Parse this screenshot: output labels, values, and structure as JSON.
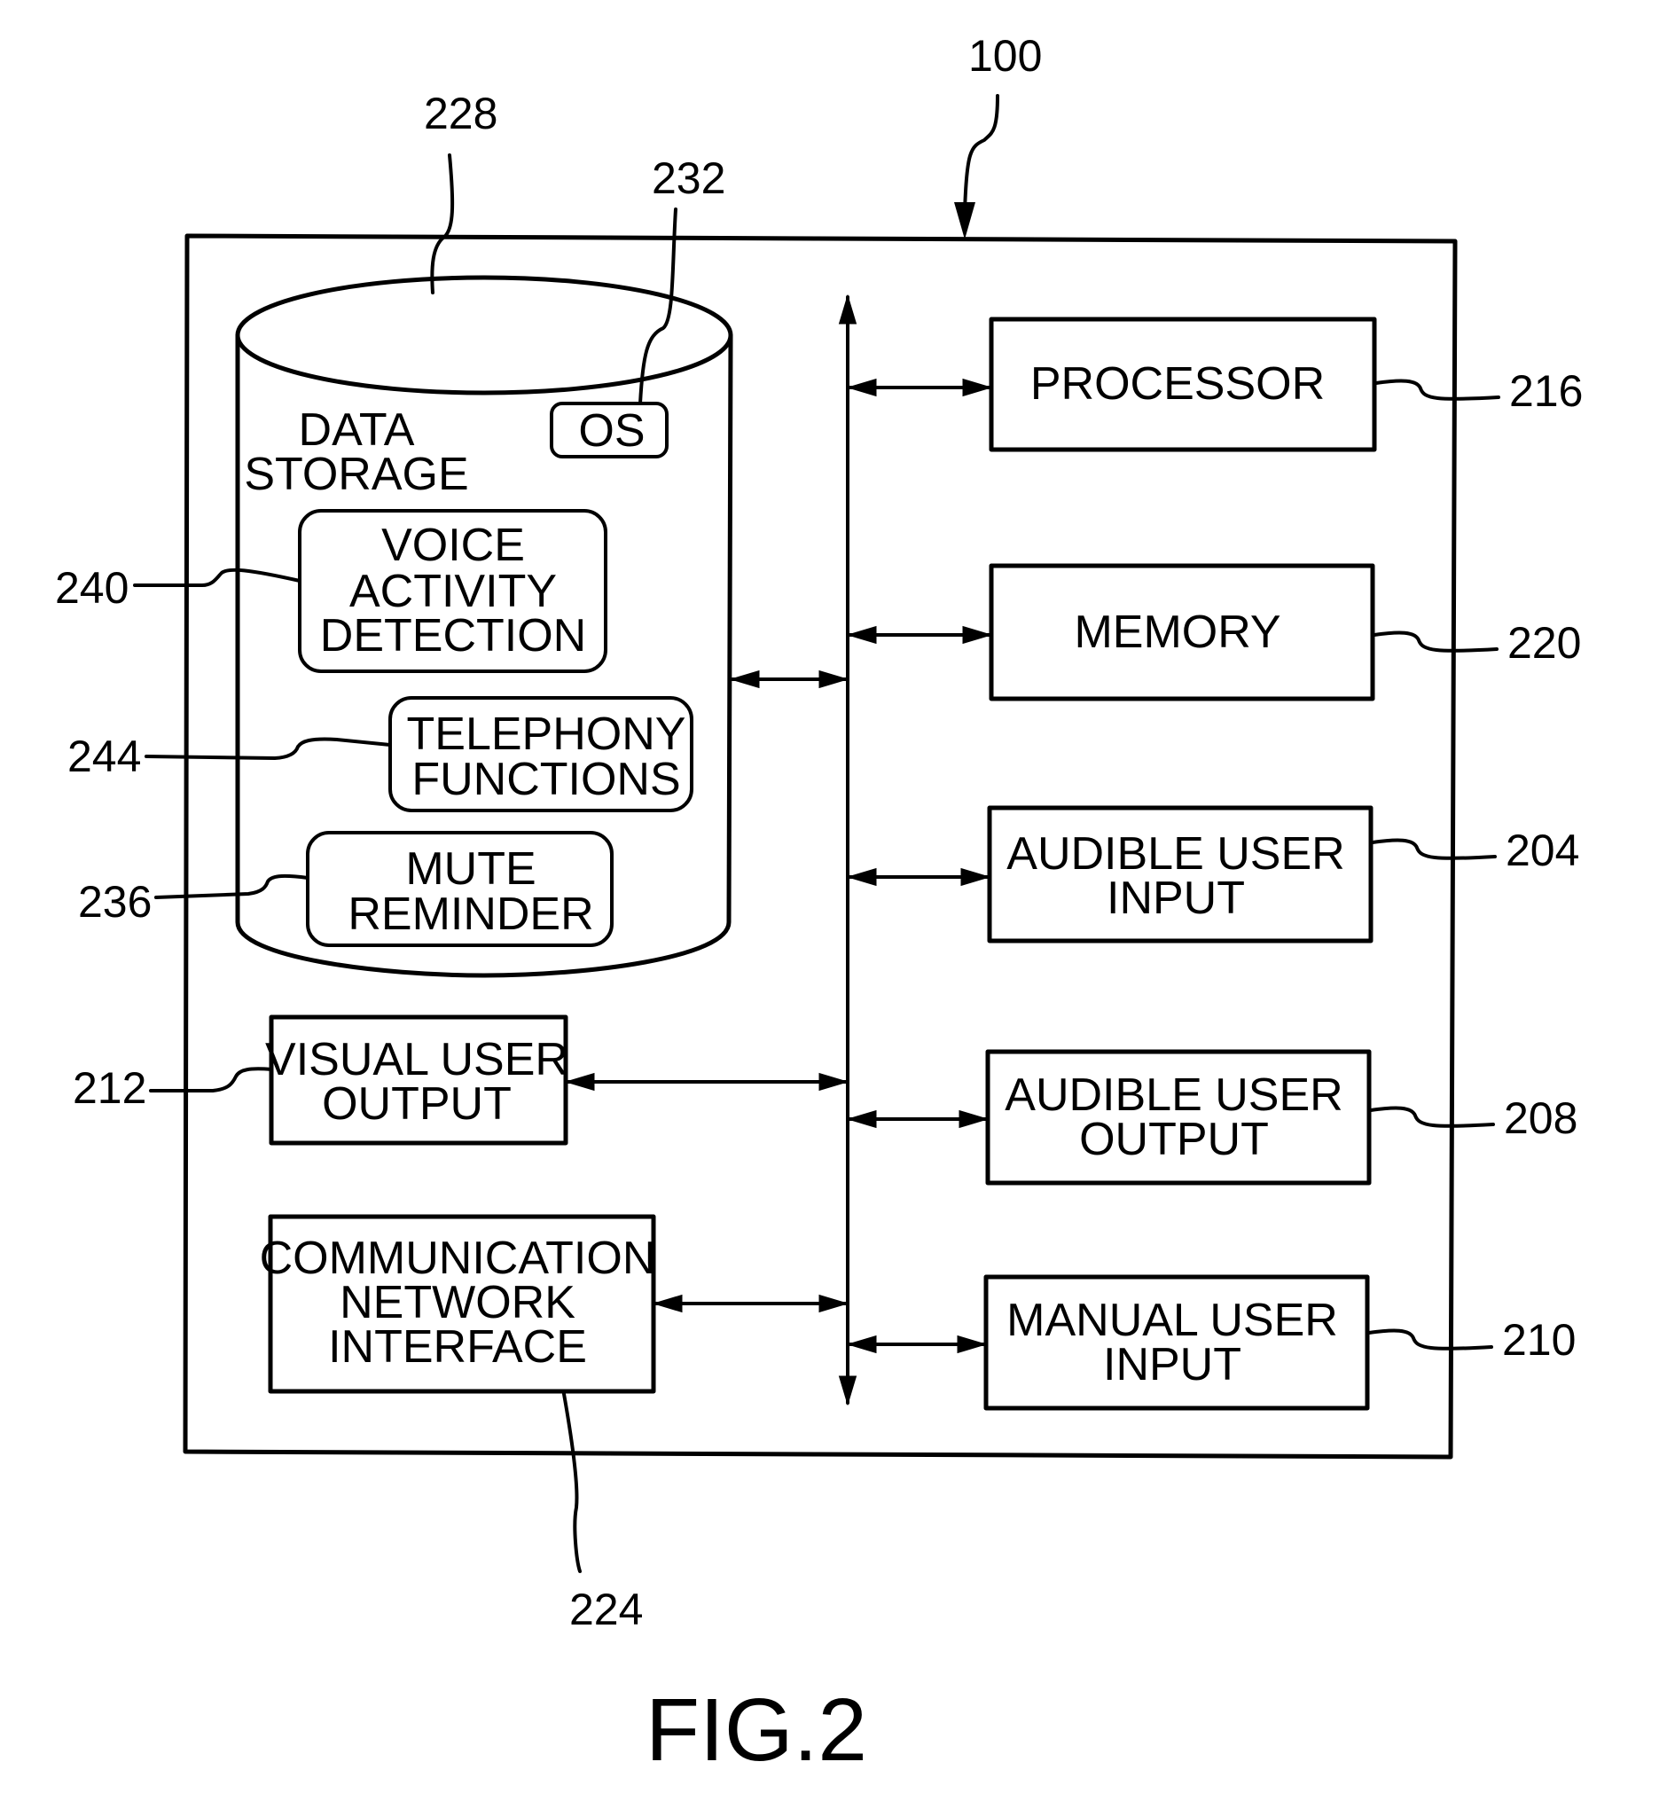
{
  "figure": {
    "caption": "FIG.2",
    "device_ref": "100"
  },
  "data_storage": {
    "ref": "228",
    "label_line1": "DATA",
    "label_line2": "STORAGE",
    "os": {
      "ref": "232",
      "label": "OS"
    },
    "modules": [
      {
        "ref": "240",
        "lines": [
          "VOICE",
          "ACTIVITY",
          "DETECTION"
        ]
      },
      {
        "ref": "244",
        "lines": [
          "TELEPHONY",
          "FUNCTIONS"
        ]
      },
      {
        "ref": "236",
        "lines": [
          "MUTE",
          "REMINDER"
        ]
      }
    ]
  },
  "right_components": [
    {
      "ref": "216",
      "lines": [
        "PROCESSOR"
      ]
    },
    {
      "ref": "220",
      "lines": [
        "MEMORY"
      ]
    },
    {
      "ref": "204",
      "lines": [
        "AUDIBLE USER",
        "INPUT"
      ]
    },
    {
      "ref": "208",
      "lines": [
        "AUDIBLE USER",
        "OUTPUT"
      ]
    },
    {
      "ref": "210",
      "lines": [
        "MANUAL USER",
        "INPUT"
      ]
    }
  ],
  "left_components": [
    {
      "ref": "212",
      "lines": [
        "VISUAL USER",
        "OUTPUT"
      ]
    },
    {
      "ref": "224",
      "lines": [
        "COMMUNICATION",
        "NETWORK",
        "INTERFACE"
      ]
    }
  ]
}
